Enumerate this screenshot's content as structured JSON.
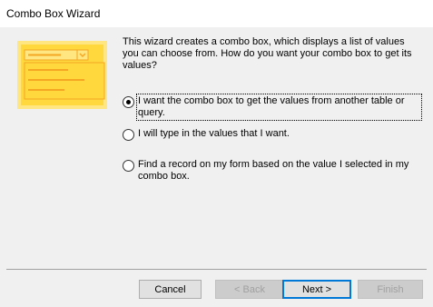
{
  "window": {
    "title": "Combo Box Wizard"
  },
  "description": "This wizard creates a combo box, which displays a list of values you can choose from.  How do you want your combo box to get its values?",
  "options": [
    {
      "label": "I want the combo box to get the values from another table or query.",
      "checked": true
    },
    {
      "label": "I will type in the values that I want.",
      "checked": false
    },
    {
      "label": "Find a record on my form based on the value I selected in my combo box.",
      "checked": false
    }
  ],
  "buttons": {
    "cancel": "Cancel",
    "back": "< Back",
    "next": "Next >",
    "finish": "Finish"
  },
  "colors": {
    "illustration_yellow": "#ffd83d",
    "illustration_light": "#ffe680",
    "illustration_orange": "#f5a623",
    "default_button_border": "#0078d7"
  }
}
